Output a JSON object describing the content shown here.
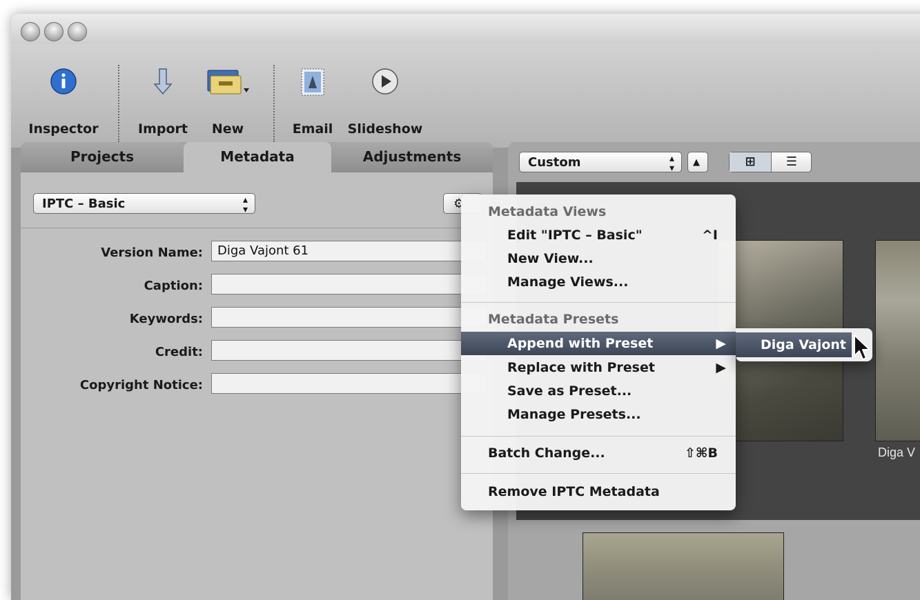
{
  "toolbar": {
    "inspector": "Inspector",
    "import": "Import",
    "new": "New",
    "email": "Email",
    "slideshow": "Slideshow"
  },
  "tabs": {
    "projects": "Projects",
    "metadata": "Metadata",
    "adjustments": "Adjustments"
  },
  "metadata_view": {
    "selected": "IPTC – Basic"
  },
  "fields": [
    {
      "label": "Version Name:",
      "value": "Diga Vajont 61"
    },
    {
      "label": "Caption:",
      "value": ""
    },
    {
      "label": "Keywords:",
      "value": ""
    },
    {
      "label": "Credit:",
      "value": ""
    },
    {
      "label": "Copyright Notice:",
      "value": ""
    }
  ],
  "browser": {
    "sort_selected": "Custom",
    "thumb_caption": "Diga V"
  },
  "menu": {
    "views_header": "Metadata Views",
    "edit_view": "Edit \"IPTC – Basic\"",
    "edit_view_shortcut": "^I",
    "new_view": "New View...",
    "manage_views": "Manage Views...",
    "presets_header": "Metadata Presets",
    "append_preset": "Append with Preset",
    "replace_preset": "Replace with Preset",
    "save_preset": "Save as Preset...",
    "manage_presets": "Manage Presets...",
    "batch_change": "Batch Change...",
    "batch_change_shortcut": "⇧⌘B",
    "remove_iptc": "Remove IPTC Metadata"
  },
  "submenu": {
    "item": "Diga Vajont"
  },
  "colors": {
    "highlight": "#4a5466",
    "info_blue": "#2f6fd0"
  }
}
